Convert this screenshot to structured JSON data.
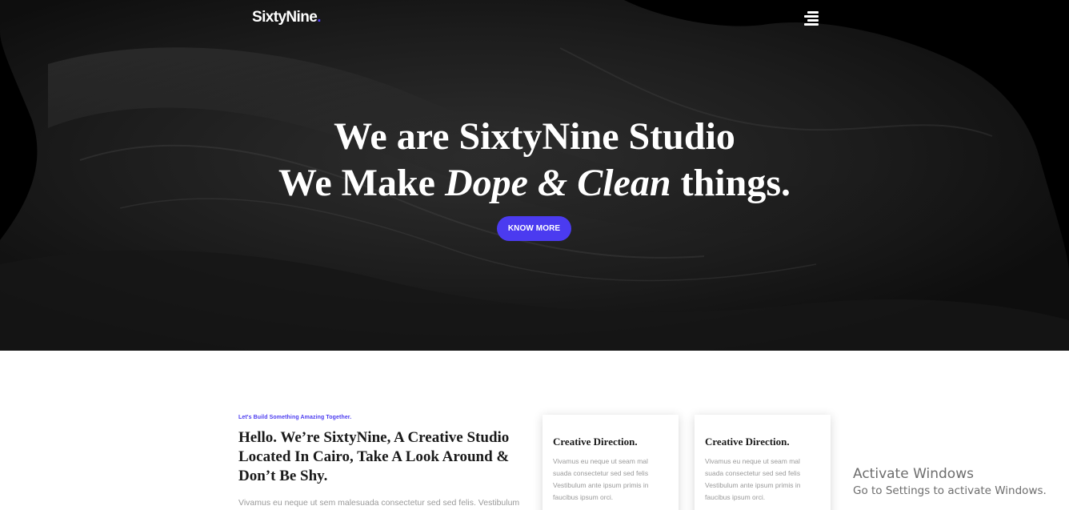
{
  "header": {
    "brand": "SixtyNine",
    "brand_dot": ".",
    "menu_icon": "hamburger-menu-icon"
  },
  "hero": {
    "line1": "We are SixtyNine Studio",
    "line2_prefix": "We Make ",
    "line2_emphasis": "Dope & Clean",
    "line2_suffix": " things.",
    "cta_label": "KNOW MORE"
  },
  "about": {
    "kicker": "Let's Build Something Amazing Together.",
    "headline": "Hello. We’re SixtyNine, A Creative Studio Located In Cairo, Take A Look Around & Don’t Be Shy.",
    "intro": "Vivamus eu neque ut sem malesuada consectetur sed sed felis. Vestibulum"
  },
  "cards": [
    {
      "title": "Creative Direction.",
      "text": "Vivamus eu neque ut seam mal suada consectetur sed sed felis Vestibulum ante ipsum primis in faucibus ipsum orci."
    },
    {
      "title": "Creative Direction.",
      "text": "Vivamus eu neque ut seam mal suada consectetur sed sed felis Vestibulum ante ipsum primis in faucibus ipsum orci."
    }
  ],
  "os_notice": {
    "title": "Activate Windows",
    "subtitle": "Go to Settings to activate Windows."
  },
  "colors": {
    "accent": "#4b3bf0",
    "hero_bg": "#000000",
    "text_dark": "#1a1a1a",
    "text_muted": "#9a9a9a"
  }
}
